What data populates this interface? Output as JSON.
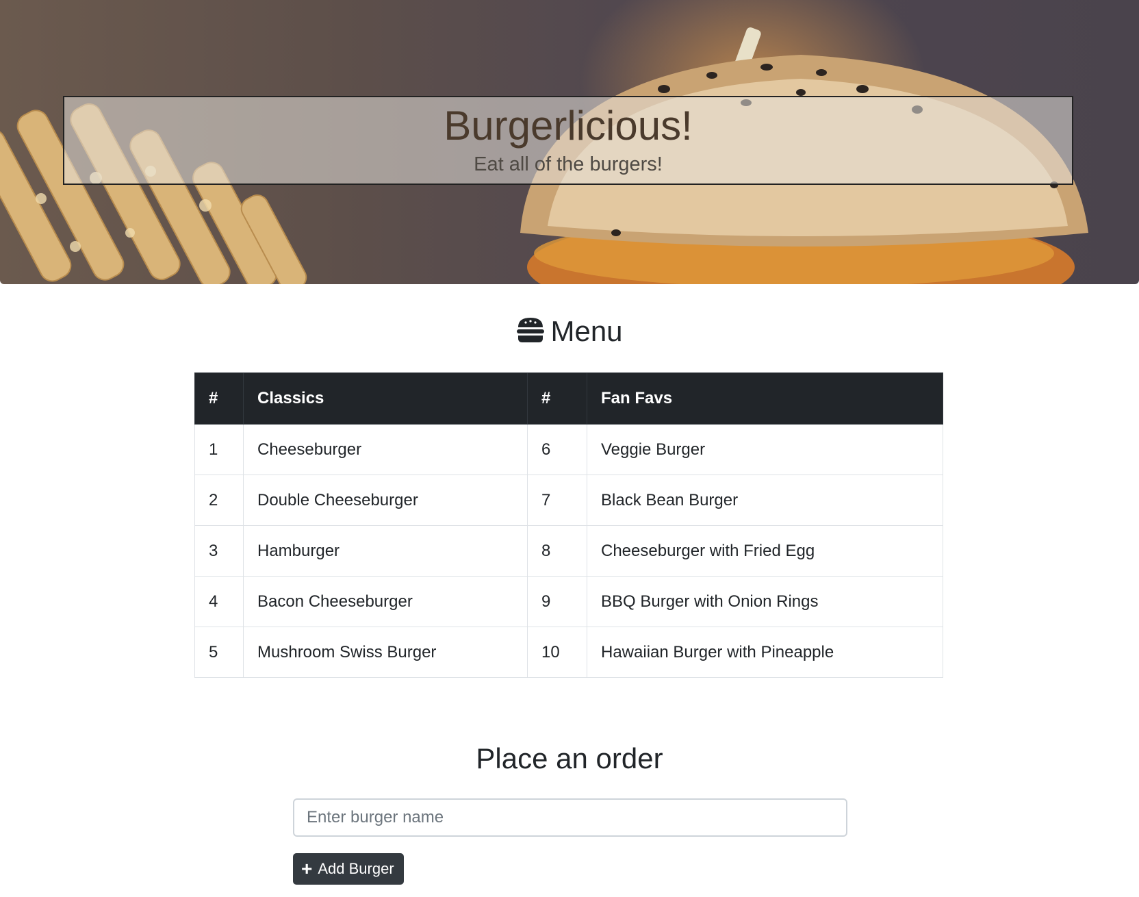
{
  "hero": {
    "title": "Burgerlicious!",
    "subtitle": "Eat all of the burgers!"
  },
  "menu": {
    "heading": "Menu",
    "icon": "hamburger-icon",
    "columns": [
      "#",
      "Classics",
      "#",
      "Fan Favs"
    ],
    "rows": [
      {
        "num1": "1",
        "classic": "Cheeseburger",
        "num2": "6",
        "fav": "Veggie Burger"
      },
      {
        "num1": "2",
        "classic": "Double Cheeseburger",
        "num2": "7",
        "fav": "Black Bean Burger"
      },
      {
        "num1": "3",
        "classic": "Hamburger",
        "num2": "8",
        "fav": "Cheeseburger with Fried Egg"
      },
      {
        "num1": "4",
        "classic": "Bacon Cheeseburger",
        "num2": "9",
        "fav": "BBQ Burger with Onion Rings"
      },
      {
        "num1": "5",
        "classic": "Mushroom Swiss Burger",
        "num2": "10",
        "fav": "Hawaiian Burger with Pineapple"
      }
    ]
  },
  "order": {
    "heading": "Place an order",
    "input_placeholder": "Enter burger name",
    "input_value": "",
    "add_button_label": "Add Burger",
    "add_button_icon": "plus-icon"
  },
  "colors": {
    "table_header_bg": "#212529",
    "button_bg": "#343a40"
  }
}
